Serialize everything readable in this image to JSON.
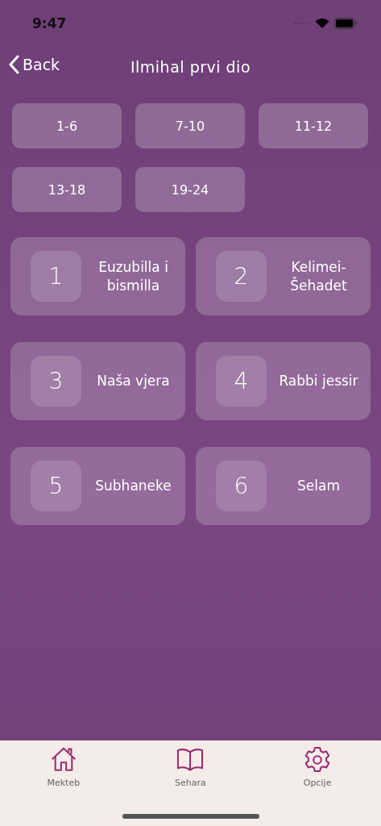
{
  "status_bar": {
    "time": "9:47"
  },
  "nav": {
    "back": "Back",
    "title": "Ilmihal prvi dio"
  },
  "ranges": [
    "1-6",
    "7-10",
    "11-12",
    "13-18",
    "19-24"
  ],
  "lessons": [
    {
      "number": "1",
      "title": "Euzubilla i bismilla"
    },
    {
      "number": "2",
      "title": "Kelimei-Šehadet"
    },
    {
      "number": "3",
      "title": "Naša vjera"
    },
    {
      "number": "4",
      "title": "Rabbi jessir"
    },
    {
      "number": "5",
      "title": "Subhaneke"
    },
    {
      "number": "6",
      "title": "Selam"
    }
  ],
  "tab_bar": [
    {
      "kind": "home",
      "label": "Mekteb"
    },
    {
      "kind": "book",
      "label": "Sehara"
    },
    {
      "kind": "gear",
      "label": "Opcije"
    }
  ]
}
